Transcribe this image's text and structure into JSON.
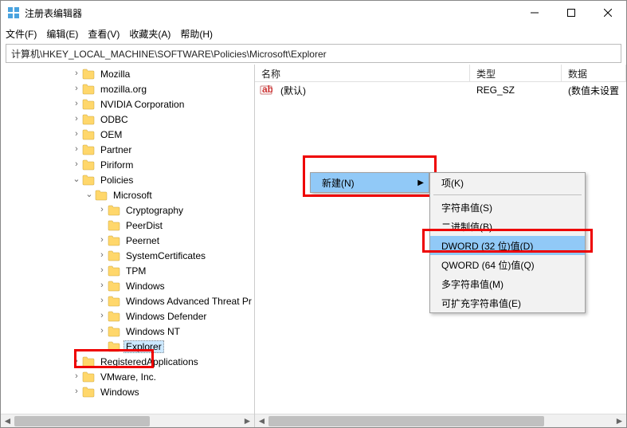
{
  "window": {
    "title": "注册表编辑器"
  },
  "menu": {
    "file": "文件(F)",
    "edit": "编辑(E)",
    "view": "查看(V)",
    "fav": "收藏夹(A)",
    "help": "帮助(H)"
  },
  "address": "计算机\\HKEY_LOCAL_MACHINE\\SOFTWARE\\Policies\\Microsoft\\Explorer",
  "tree": [
    {
      "depth": 3,
      "exp": ">",
      "label": "Mozilla"
    },
    {
      "depth": 3,
      "exp": ">",
      "label": "mozilla.org"
    },
    {
      "depth": 3,
      "exp": ">",
      "label": "NVIDIA Corporation"
    },
    {
      "depth": 3,
      "exp": ">",
      "label": "ODBC"
    },
    {
      "depth": 3,
      "exp": ">",
      "label": "OEM"
    },
    {
      "depth": 3,
      "exp": ">",
      "label": "Partner"
    },
    {
      "depth": 3,
      "exp": ">",
      "label": "Piriform"
    },
    {
      "depth": 3,
      "exp": "v",
      "label": "Policies"
    },
    {
      "depth": 4,
      "exp": "v",
      "label": "Microsoft"
    },
    {
      "depth": 5,
      "exp": ">",
      "label": "Cryptography"
    },
    {
      "depth": 5,
      "exp": "",
      "label": "PeerDist"
    },
    {
      "depth": 5,
      "exp": ">",
      "label": "Peernet"
    },
    {
      "depth": 5,
      "exp": ">",
      "label": "SystemCertificates"
    },
    {
      "depth": 5,
      "exp": ">",
      "label": "TPM"
    },
    {
      "depth": 5,
      "exp": ">",
      "label": "Windows"
    },
    {
      "depth": 5,
      "exp": ">",
      "label": "Windows Advanced Threat Pr"
    },
    {
      "depth": 5,
      "exp": ">",
      "label": "Windows Defender"
    },
    {
      "depth": 5,
      "exp": ">",
      "label": "Windows NT"
    },
    {
      "depth": 5,
      "exp": "",
      "label": "Explorer",
      "selected": true
    },
    {
      "depth": 3,
      "exp": ">",
      "label": "RegisteredApplications"
    },
    {
      "depth": 3,
      "exp": ">",
      "label": "VMware, Inc."
    },
    {
      "depth": 3,
      "exp": ">",
      "label": "Windows"
    }
  ],
  "columns": {
    "name": "名称",
    "type": "类型",
    "data": "数据"
  },
  "row": {
    "name": "(默认)",
    "type": "REG_SZ",
    "data": "(数值未设置"
  },
  "context": {
    "new": "新建(N)",
    "sub": {
      "key": "项(K)",
      "string": "字符串值(S)",
      "binary": "二进制值(B)",
      "dword": "DWORD (32 位)值(D)",
      "qword": "QWORD (64 位)值(Q)",
      "multi": "多字符串值(M)",
      "expand": "可扩充字符串值(E)"
    }
  }
}
